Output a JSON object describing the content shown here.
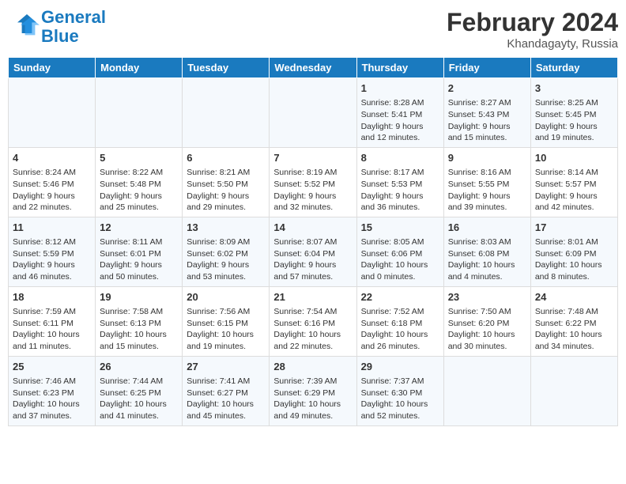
{
  "header": {
    "logo_line1": "General",
    "logo_line2": "Blue",
    "month_year": "February 2024",
    "location": "Khandagayty, Russia"
  },
  "days_of_week": [
    "Sunday",
    "Monday",
    "Tuesday",
    "Wednesday",
    "Thursday",
    "Friday",
    "Saturday"
  ],
  "weeks": [
    [
      {
        "day": "",
        "content": ""
      },
      {
        "day": "",
        "content": ""
      },
      {
        "day": "",
        "content": ""
      },
      {
        "day": "",
        "content": ""
      },
      {
        "day": "1",
        "content": "Sunrise: 8:28 AM\nSunset: 5:41 PM\nDaylight: 9 hours\nand 12 minutes."
      },
      {
        "day": "2",
        "content": "Sunrise: 8:27 AM\nSunset: 5:43 PM\nDaylight: 9 hours\nand 15 minutes."
      },
      {
        "day": "3",
        "content": "Sunrise: 8:25 AM\nSunset: 5:45 PM\nDaylight: 9 hours\nand 19 minutes."
      }
    ],
    [
      {
        "day": "4",
        "content": "Sunrise: 8:24 AM\nSunset: 5:46 PM\nDaylight: 9 hours\nand 22 minutes."
      },
      {
        "day": "5",
        "content": "Sunrise: 8:22 AM\nSunset: 5:48 PM\nDaylight: 9 hours\nand 25 minutes."
      },
      {
        "day": "6",
        "content": "Sunrise: 8:21 AM\nSunset: 5:50 PM\nDaylight: 9 hours\nand 29 minutes."
      },
      {
        "day": "7",
        "content": "Sunrise: 8:19 AM\nSunset: 5:52 PM\nDaylight: 9 hours\nand 32 minutes."
      },
      {
        "day": "8",
        "content": "Sunrise: 8:17 AM\nSunset: 5:53 PM\nDaylight: 9 hours\nand 36 minutes."
      },
      {
        "day": "9",
        "content": "Sunrise: 8:16 AM\nSunset: 5:55 PM\nDaylight: 9 hours\nand 39 minutes."
      },
      {
        "day": "10",
        "content": "Sunrise: 8:14 AM\nSunset: 5:57 PM\nDaylight: 9 hours\nand 42 minutes."
      }
    ],
    [
      {
        "day": "11",
        "content": "Sunrise: 8:12 AM\nSunset: 5:59 PM\nDaylight: 9 hours\nand 46 minutes."
      },
      {
        "day": "12",
        "content": "Sunrise: 8:11 AM\nSunset: 6:01 PM\nDaylight: 9 hours\nand 50 minutes."
      },
      {
        "day": "13",
        "content": "Sunrise: 8:09 AM\nSunset: 6:02 PM\nDaylight: 9 hours\nand 53 minutes."
      },
      {
        "day": "14",
        "content": "Sunrise: 8:07 AM\nSunset: 6:04 PM\nDaylight: 9 hours\nand 57 minutes."
      },
      {
        "day": "15",
        "content": "Sunrise: 8:05 AM\nSunset: 6:06 PM\nDaylight: 10 hours\nand 0 minutes."
      },
      {
        "day": "16",
        "content": "Sunrise: 8:03 AM\nSunset: 6:08 PM\nDaylight: 10 hours\nand 4 minutes."
      },
      {
        "day": "17",
        "content": "Sunrise: 8:01 AM\nSunset: 6:09 PM\nDaylight: 10 hours\nand 8 minutes."
      }
    ],
    [
      {
        "day": "18",
        "content": "Sunrise: 7:59 AM\nSunset: 6:11 PM\nDaylight: 10 hours\nand 11 minutes."
      },
      {
        "day": "19",
        "content": "Sunrise: 7:58 AM\nSunset: 6:13 PM\nDaylight: 10 hours\nand 15 minutes."
      },
      {
        "day": "20",
        "content": "Sunrise: 7:56 AM\nSunset: 6:15 PM\nDaylight: 10 hours\nand 19 minutes."
      },
      {
        "day": "21",
        "content": "Sunrise: 7:54 AM\nSunset: 6:16 PM\nDaylight: 10 hours\nand 22 minutes."
      },
      {
        "day": "22",
        "content": "Sunrise: 7:52 AM\nSunset: 6:18 PM\nDaylight: 10 hours\nand 26 minutes."
      },
      {
        "day": "23",
        "content": "Sunrise: 7:50 AM\nSunset: 6:20 PM\nDaylight: 10 hours\nand 30 minutes."
      },
      {
        "day": "24",
        "content": "Sunrise: 7:48 AM\nSunset: 6:22 PM\nDaylight: 10 hours\nand 34 minutes."
      }
    ],
    [
      {
        "day": "25",
        "content": "Sunrise: 7:46 AM\nSunset: 6:23 PM\nDaylight: 10 hours\nand 37 minutes."
      },
      {
        "day": "26",
        "content": "Sunrise: 7:44 AM\nSunset: 6:25 PM\nDaylight: 10 hours\nand 41 minutes."
      },
      {
        "day": "27",
        "content": "Sunrise: 7:41 AM\nSunset: 6:27 PM\nDaylight: 10 hours\nand 45 minutes."
      },
      {
        "day": "28",
        "content": "Sunrise: 7:39 AM\nSunset: 6:29 PM\nDaylight: 10 hours\nand 49 minutes."
      },
      {
        "day": "29",
        "content": "Sunrise: 7:37 AM\nSunset: 6:30 PM\nDaylight: 10 hours\nand 52 minutes."
      },
      {
        "day": "",
        "content": ""
      },
      {
        "day": "",
        "content": ""
      }
    ]
  ]
}
